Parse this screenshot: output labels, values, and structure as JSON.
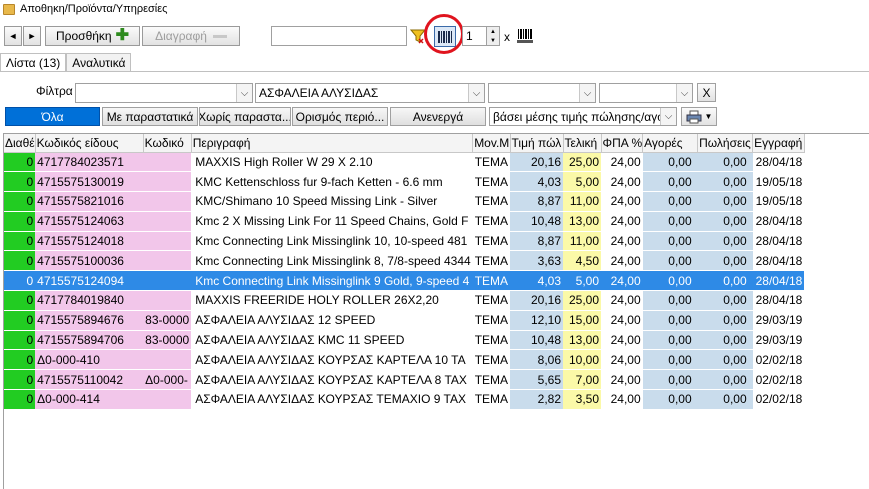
{
  "window": {
    "title": "Αποθηκη/Προϊόντα/Υπηρεσίες"
  },
  "toolbar": {
    "prev_label": "◄",
    "next_label": "►",
    "add_label": "Προσθήκη",
    "delete_label": "Διαγραφή",
    "search_value": "",
    "quantity_value": "1",
    "times_label": "x"
  },
  "tabs": [
    {
      "label": "Λίστα (13)",
      "active": true
    },
    {
      "label": "Αναλυτικά",
      "active": false
    }
  ],
  "filters": {
    "label": "Φίλτρα",
    "combo1": "",
    "combo2": "ΑΣΦΑΛΕΙΑ ΑΛΥΣΙΔΑΣ",
    "combo3": "",
    "combo4": "",
    "clear_label": "X"
  },
  "filter_buttons": [
    {
      "label": "Όλα",
      "active": true
    },
    {
      "label": "Με παραστατικά",
      "active": false
    },
    {
      "label": "Χωρίς παραστα...",
      "active": false
    },
    {
      "label": "Ορισμός περιό...",
      "active": false
    },
    {
      "label": "Ανενεργά",
      "active": false
    }
  ],
  "price_mode": "βάσει μέσης τιμής πώλησης/αγο",
  "columns": [
    "Διαθέ",
    "Κωδικός είδους",
    "Κωδικό",
    "Περιγραφή",
    "Mov.M",
    "Τιμή πώλ",
    "Τελική",
    "ΦΠΑ %",
    "Αγορές",
    "Πωλήσεις",
    "Εγγραφή"
  ],
  "rows": [
    {
      "stock": "0",
      "code": "4717784023571",
      "code2": "",
      "desc": " MAXXIS High Roller W 29 X 2.10",
      "unit": "ΤΕΜΑ",
      "price": "20,16",
      "final": "25,00",
      "vat": "24,00",
      "buys": "0,00",
      "sales": "0,00",
      "date": "28/04/18",
      "selected": false
    },
    {
      "stock": "0",
      "code": "4715575130019",
      "code2": "",
      "desc": "KMC Kettenschloss fur 9-fach Ketten - 6.6 mm",
      "unit": "ΤΕΜΑ",
      "price": "4,03",
      "final": "5,00",
      "vat": "24,00",
      "buys": "0,00",
      "sales": "0,00",
      "date": "19/05/18",
      "selected": false
    },
    {
      "stock": "0",
      "code": "4715575821016",
      "code2": "",
      "desc": "KMC/Shimano 10 Speed Missing Link - Silver",
      "unit": "ΤΕΜΑ",
      "price": "8,87",
      "final": "11,00",
      "vat": "24,00",
      "buys": "0,00",
      "sales": "0,00",
      "date": "19/05/18",
      "selected": false
    },
    {
      "stock": "0",
      "code": "4715575124063",
      "code2": "",
      "desc": "Kmc 2 X Missing Link For 11 Speed Chains, Gold F",
      "unit": "ΤΕΜΑ",
      "price": "10,48",
      "final": "13,00",
      "vat": "24,00",
      "buys": "0,00",
      "sales": "0,00",
      "date": "28/04/18",
      "selected": false
    },
    {
      "stock": "0",
      "code": "4715575124018",
      "code2": "",
      "desc": "Kmc Connecting Link Missinglink 10, 10-speed 481",
      "unit": "ΤΕΜΑ",
      "price": "8,87",
      "final": "11,00",
      "vat": "24,00",
      "buys": "0,00",
      "sales": "0,00",
      "date": "28/04/18",
      "selected": false
    },
    {
      "stock": "0",
      "code": "4715575100036",
      "code2": "",
      "desc": "Kmc Connecting Link Missinglink 8, 7/8-speed 4344",
      "unit": "ΤΕΜΑ",
      "price": "3,63",
      "final": "4,50",
      "vat": "24,00",
      "buys": "0,00",
      "sales": "0,00",
      "date": "28/04/18",
      "selected": false
    },
    {
      "stock": "0",
      "code": "4715575124094",
      "code2": "",
      "desc": "Kmc Connecting Link Missinglink 9 Gold, 9-speed 4",
      "unit": "ΤΕΜΑ",
      "price": "4,03",
      "final": "5,00",
      "vat": "24,00",
      "buys": "0,00",
      "sales": "0,00",
      "date": "28/04/18",
      "selected": true
    },
    {
      "stock": "0",
      "code": "4717784019840",
      "code2": "",
      "desc": "MAXXIS FREERIDE HOLY ROLLER 26X2,20",
      "unit": "ΤΕΜΑ",
      "price": "20,16",
      "final": "25,00",
      "vat": "24,00",
      "buys": "0,00",
      "sales": "0,00",
      "date": "28/04/18",
      "selected": false
    },
    {
      "stock": "0",
      "code": "4715575894676",
      "code2": "83-0000",
      "desc": "ΑΣΦΑΛΕΙΑ ΑΛΥΣΙΔΑΣ 12 SPEED",
      "unit": "ΤΕΜΑ",
      "price": "12,10",
      "final": "15,00",
      "vat": "24,00",
      "buys": "0,00",
      "sales": "0,00",
      "date": "29/03/19",
      "selected": false
    },
    {
      "stock": "0",
      "code": "4715575894706",
      "code2": "83-0000",
      "desc": "ΑΣΦΑΛΕΙΑ ΑΛΥΣΙΔΑΣ KMC 11 SPEED",
      "unit": "ΤΕΜΑ",
      "price": "10,48",
      "final": "13,00",
      "vat": "24,00",
      "buys": "0,00",
      "sales": "0,00",
      "date": "29/03/19",
      "selected": false
    },
    {
      "stock": "0",
      "code": "Δ0-000-410",
      "code2": "",
      "desc": "ΑΣΦΑΛΕΙΑ ΑΛΥΣΙΔΑΣ ΚΟΥΡΣΑΣ ΚΑΡΤΕΛΑ 10 ΤΑ",
      "unit": "ΤΕΜΑ",
      "price": "8,06",
      "final": "10,00",
      "vat": "24,00",
      "buys": "0,00",
      "sales": "0,00",
      "date": "02/02/18",
      "selected": false
    },
    {
      "stock": "0",
      "code": "4715575110042",
      "code2": "Δ0-000-",
      "desc": "ΑΣΦΑΛΕΙΑ ΑΛΥΣΙΔΑΣ ΚΟΥΡΣΑΣ ΚΑΡΤΕΛΑ 8 ΤΑΧ",
      "unit": "ΤΕΜΑ",
      "price": "5,65",
      "final": "7,00",
      "vat": "24,00",
      "buys": "0,00",
      "sales": "0,00",
      "date": "02/02/18",
      "selected": false
    },
    {
      "stock": "0",
      "code": "Δ0-000-414",
      "code2": "",
      "desc": "ΑΣΦΑΛΕΙΑ ΑΛΥΣΙΔΑΣ ΚΟΥΡΣΑΣ ΤΕΜΑΧΙΟ 9 ΤΑΧ",
      "unit": "ΤΕΜΑ",
      "price": "2,82",
      "final": "3,50",
      "vat": "24,00",
      "buys": "0,00",
      "sales": "0,00",
      "date": "02/02/18",
      "selected": false
    }
  ]
}
